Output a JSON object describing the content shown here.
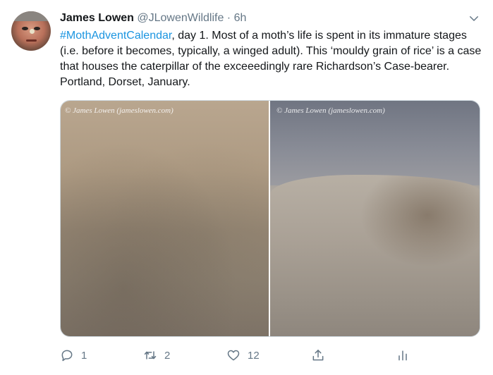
{
  "tweet": {
    "author_name": "James Lowen",
    "handle": "@JLowenWildlife",
    "separator": "·",
    "time": "6h",
    "hashtag": "#MothAdventCalendar",
    "body": ", day 1. Most of a moth’s life is spent in its immature stages (i.e. before it becomes, typically, a winged adult). This ‘mouldy grain of rice’ is a case that houses the caterpillar of the exceeedingly rare Richardson’s Case-bearer. Portland, Dorset, January.",
    "photo_credit_left": "© James Lowen (jameslowen.com)",
    "photo_credit_right": "© James Lowen (jameslowen.com)",
    "actions": {
      "reply_count": "1",
      "retweet_count": "2",
      "like_count": "12"
    }
  },
  "icons": {
    "menu": "chevron-down-icon",
    "reply": "reply-icon",
    "retweet": "retweet-icon",
    "like": "heart-icon",
    "share": "share-icon",
    "analytics": "analytics-icon"
  },
  "colors": {
    "link": "#1b95e0",
    "muted": "#657786",
    "text": "#14171a"
  }
}
